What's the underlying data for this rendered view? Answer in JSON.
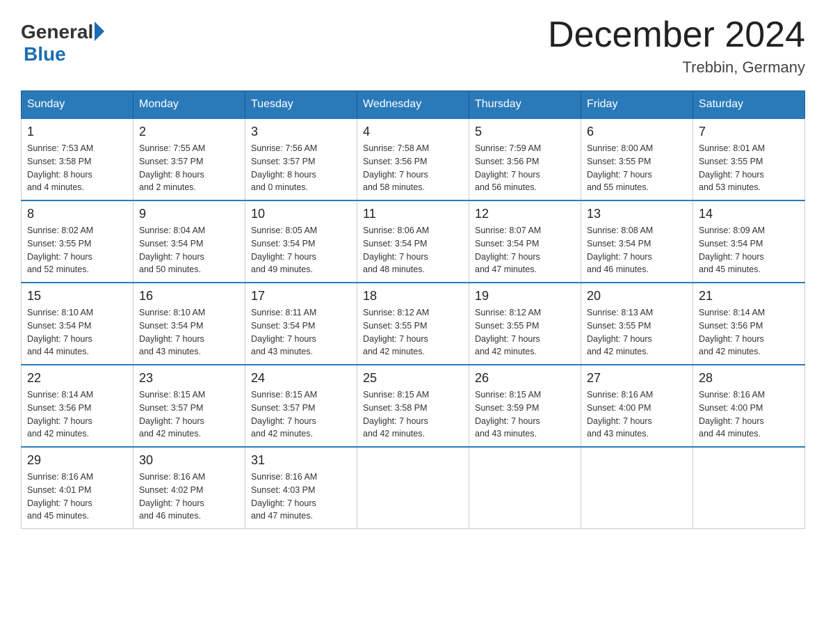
{
  "logo": {
    "general": "General",
    "blue": "Blue"
  },
  "title": "December 2024",
  "location": "Trebbin, Germany",
  "days_header": [
    "Sunday",
    "Monday",
    "Tuesday",
    "Wednesday",
    "Thursday",
    "Friday",
    "Saturday"
  ],
  "weeks": [
    [
      {
        "day": "1",
        "sunrise": "7:53 AM",
        "sunset": "3:58 PM",
        "daylight": "8 hours and 4 minutes."
      },
      {
        "day": "2",
        "sunrise": "7:55 AM",
        "sunset": "3:57 PM",
        "daylight": "8 hours and 2 minutes."
      },
      {
        "day": "3",
        "sunrise": "7:56 AM",
        "sunset": "3:57 PM",
        "daylight": "8 hours and 0 minutes."
      },
      {
        "day": "4",
        "sunrise": "7:58 AM",
        "sunset": "3:56 PM",
        "daylight": "7 hours and 58 minutes."
      },
      {
        "day": "5",
        "sunrise": "7:59 AM",
        "sunset": "3:56 PM",
        "daylight": "7 hours and 56 minutes."
      },
      {
        "day": "6",
        "sunrise": "8:00 AM",
        "sunset": "3:55 PM",
        "daylight": "7 hours and 55 minutes."
      },
      {
        "day": "7",
        "sunrise": "8:01 AM",
        "sunset": "3:55 PM",
        "daylight": "7 hours and 53 minutes."
      }
    ],
    [
      {
        "day": "8",
        "sunrise": "8:02 AM",
        "sunset": "3:55 PM",
        "daylight": "7 hours and 52 minutes."
      },
      {
        "day": "9",
        "sunrise": "8:04 AM",
        "sunset": "3:54 PM",
        "daylight": "7 hours and 50 minutes."
      },
      {
        "day": "10",
        "sunrise": "8:05 AM",
        "sunset": "3:54 PM",
        "daylight": "7 hours and 49 minutes."
      },
      {
        "day": "11",
        "sunrise": "8:06 AM",
        "sunset": "3:54 PM",
        "daylight": "7 hours and 48 minutes."
      },
      {
        "day": "12",
        "sunrise": "8:07 AM",
        "sunset": "3:54 PM",
        "daylight": "7 hours and 47 minutes."
      },
      {
        "day": "13",
        "sunrise": "8:08 AM",
        "sunset": "3:54 PM",
        "daylight": "7 hours and 46 minutes."
      },
      {
        "day": "14",
        "sunrise": "8:09 AM",
        "sunset": "3:54 PM",
        "daylight": "7 hours and 45 minutes."
      }
    ],
    [
      {
        "day": "15",
        "sunrise": "8:10 AM",
        "sunset": "3:54 PM",
        "daylight": "7 hours and 44 minutes."
      },
      {
        "day": "16",
        "sunrise": "8:10 AM",
        "sunset": "3:54 PM",
        "daylight": "7 hours and 43 minutes."
      },
      {
        "day": "17",
        "sunrise": "8:11 AM",
        "sunset": "3:54 PM",
        "daylight": "7 hours and 43 minutes."
      },
      {
        "day": "18",
        "sunrise": "8:12 AM",
        "sunset": "3:55 PM",
        "daylight": "7 hours and 42 minutes."
      },
      {
        "day": "19",
        "sunrise": "8:12 AM",
        "sunset": "3:55 PM",
        "daylight": "7 hours and 42 minutes."
      },
      {
        "day": "20",
        "sunrise": "8:13 AM",
        "sunset": "3:55 PM",
        "daylight": "7 hours and 42 minutes."
      },
      {
        "day": "21",
        "sunrise": "8:14 AM",
        "sunset": "3:56 PM",
        "daylight": "7 hours and 42 minutes."
      }
    ],
    [
      {
        "day": "22",
        "sunrise": "8:14 AM",
        "sunset": "3:56 PM",
        "daylight": "7 hours and 42 minutes."
      },
      {
        "day": "23",
        "sunrise": "8:15 AM",
        "sunset": "3:57 PM",
        "daylight": "7 hours and 42 minutes."
      },
      {
        "day": "24",
        "sunrise": "8:15 AM",
        "sunset": "3:57 PM",
        "daylight": "7 hours and 42 minutes."
      },
      {
        "day": "25",
        "sunrise": "8:15 AM",
        "sunset": "3:58 PM",
        "daylight": "7 hours and 42 minutes."
      },
      {
        "day": "26",
        "sunrise": "8:15 AM",
        "sunset": "3:59 PM",
        "daylight": "7 hours and 43 minutes."
      },
      {
        "day": "27",
        "sunrise": "8:16 AM",
        "sunset": "4:00 PM",
        "daylight": "7 hours and 43 minutes."
      },
      {
        "day": "28",
        "sunrise": "8:16 AM",
        "sunset": "4:00 PM",
        "daylight": "7 hours and 44 minutes."
      }
    ],
    [
      {
        "day": "29",
        "sunrise": "8:16 AM",
        "sunset": "4:01 PM",
        "daylight": "7 hours and 45 minutes."
      },
      {
        "day": "30",
        "sunrise": "8:16 AM",
        "sunset": "4:02 PM",
        "daylight": "7 hours and 46 minutes."
      },
      {
        "day": "31",
        "sunrise": "8:16 AM",
        "sunset": "4:03 PM",
        "daylight": "7 hours and 47 minutes."
      },
      null,
      null,
      null,
      null
    ]
  ],
  "labels": {
    "sunrise": "Sunrise:",
    "sunset": "Sunset:",
    "daylight": "Daylight:"
  }
}
